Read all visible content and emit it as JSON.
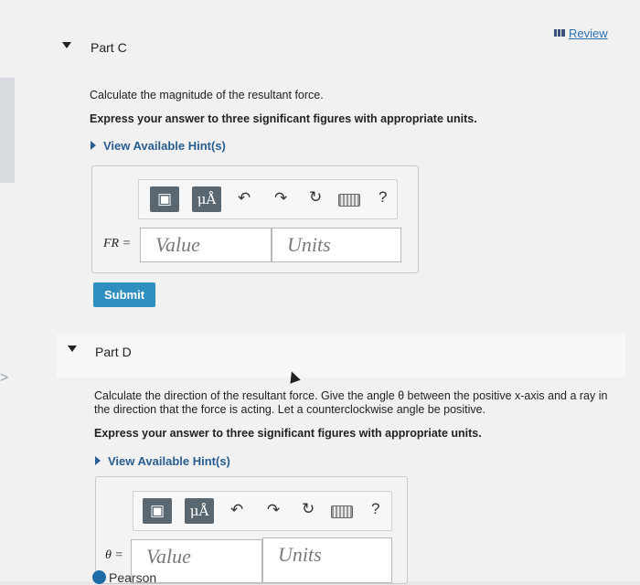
{
  "review_label": "Review",
  "partC": {
    "title": "Part C",
    "prompt": "Calculate the magnitude of the resultant force.",
    "instruction": "Express your answer to three significant figures with appropriate units.",
    "hint_link": "View Available Hint(s)",
    "variable_label": "FR =",
    "value_placeholder": "Value",
    "units_placeholder": "Units",
    "unit_symbol_btn": "μÅ",
    "help_icon": "?",
    "submit_label": "Submit"
  },
  "partD": {
    "title": "Part D",
    "prompt": "Calculate the direction of the resultant force. Give the angle θ between the positive x-axis and a ray in the direction that the force is acting. Let a counterclockwise angle be positive.",
    "instruction": "Express your answer to three significant figures with appropriate units.",
    "hint_link": "View Available Hint(s)",
    "variable_label": "θ =",
    "value_placeholder": "Value",
    "units_placeholder": "Units",
    "unit_symbol_btn": "μÅ",
    "help_icon": "?"
  },
  "brand": "Pearson",
  "icons": [
    "templates-icon",
    "units-icon",
    "undo-icon",
    "redo-icon",
    "reset-icon",
    "keyboard-icon",
    "help-icon",
    "caret-down-icon",
    "play-triangle-icon",
    "review-bars-icon"
  ],
  "colors": {
    "link": "#2a5d8f",
    "submit": "#2f8fbe",
    "toolbar_button": "#5b6770"
  }
}
